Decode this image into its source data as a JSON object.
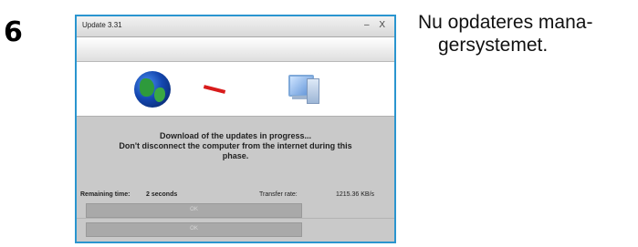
{
  "step": {
    "number": "6"
  },
  "caption": {
    "line1": "Nu opdateres mana-",
    "line2": "gersystemet."
  },
  "window": {
    "title": "Update 3.31",
    "controls": "–  X",
    "message_line1": "Download of the updates in progress...",
    "message_line2": "Don't disconnect the computer from the internet during this",
    "message_line3": "phase.",
    "remaining_label": "Remaining time:",
    "remaining_value": "2 seconds",
    "transfer_label": "Transfer rate:",
    "transfer_value": "1215.36 KB/s",
    "bar1_label": "OK",
    "bar2_label": "OK"
  },
  "colors": {
    "window_border": "#2a95cf",
    "progress_dash": "#d81b1b"
  }
}
